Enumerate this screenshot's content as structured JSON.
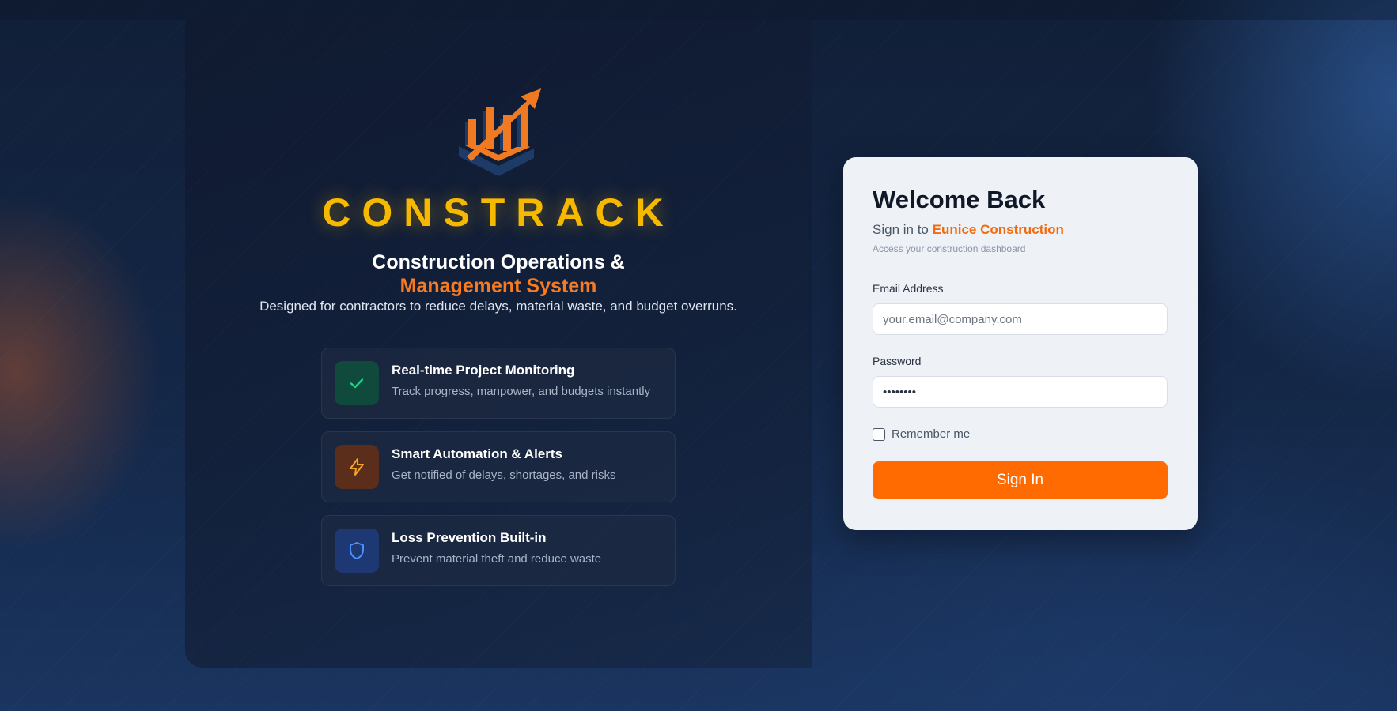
{
  "brand": {
    "name": "CONSTRACK",
    "subtitle_line1": "Construction Operations &",
    "subtitle_line2": "Management System",
    "tagline": "Designed for contractors to reduce delays, material waste, and budget overruns."
  },
  "features": [
    {
      "title": "Real-time Project Monitoring",
      "description": "Track progress, manpower, and budgets instantly",
      "icon": "check-icon",
      "color": "#1fd08a"
    },
    {
      "title": "Smart Automation & Alerts",
      "description": "Get notified of delays, shortages, and risks",
      "icon": "lightning-icon",
      "color": "#f5a623"
    },
    {
      "title": "Loss Prevention Built-in",
      "description": "Prevent material theft and reduce waste",
      "icon": "shield-icon",
      "color": "#4f8ff7"
    }
  ],
  "login": {
    "title": "Welcome Back",
    "sign_in_prefix": "Sign in to",
    "organization": "Eunice Construction",
    "access_text": "Access your construction dashboard",
    "email_label": "Email Address",
    "email_placeholder": "your.email@company.com",
    "password_label": "Password",
    "password_value": "password",
    "remember_label": "Remember me",
    "submit_label": "Sign In"
  },
  "colors": {
    "brand_yellow": "#f7b800",
    "accent_orange": "#f97a1f",
    "button_orange": "#ff6b00"
  }
}
